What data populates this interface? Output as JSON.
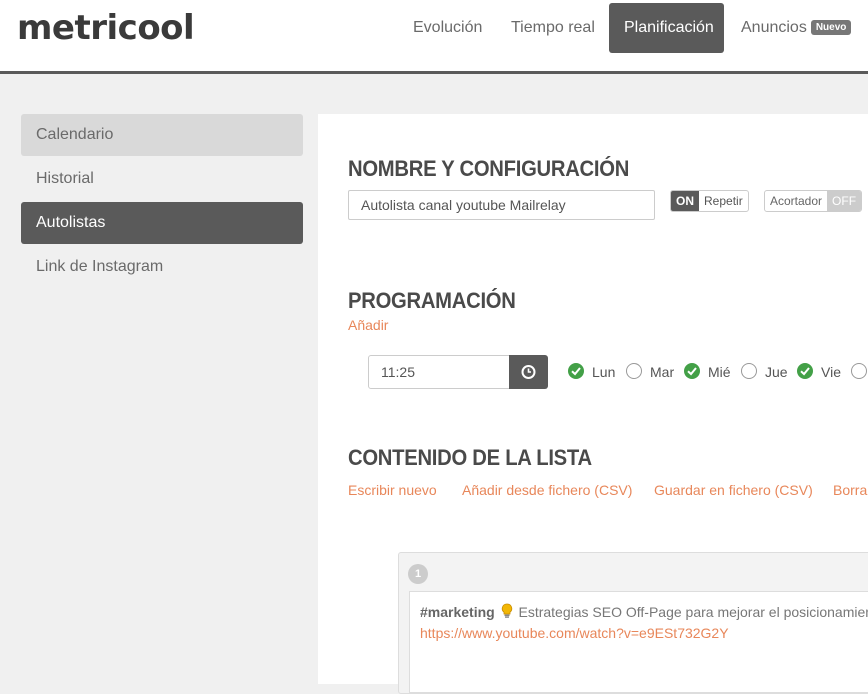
{
  "app": {
    "logo": "metricool"
  },
  "nav": {
    "items": [
      {
        "label": "Evolución"
      },
      {
        "label": "Tiempo real"
      },
      {
        "label": "Planificación"
      },
      {
        "label": "Anuncios",
        "badge": "Nuevo"
      }
    ]
  },
  "sidebar": {
    "items": [
      {
        "label": "Calendario"
      },
      {
        "label": "Historial"
      },
      {
        "label": "Autolistas"
      },
      {
        "label": "Link de Instagram"
      }
    ]
  },
  "config": {
    "title": "NOMBRE Y CONFIGURACIÓN",
    "name_value": "Autolista canal youtube Mailrelay",
    "repeat_on": "ON",
    "repeat_label": "Repetir",
    "shortener_label": "Acortador",
    "shortener_off": "OFF"
  },
  "schedule": {
    "title": "PROGRAMACIÓN",
    "add_link": "Añadir",
    "time_value": "11:25",
    "days": [
      {
        "label": "Lun",
        "checked": true
      },
      {
        "label": "Mar",
        "checked": false
      },
      {
        "label": "Mié",
        "checked": true
      },
      {
        "label": "Jue",
        "checked": false
      },
      {
        "label": "Vie",
        "checked": true
      },
      {
        "label": "",
        "checked": false
      }
    ]
  },
  "content": {
    "title": "CONTENIDO DE LA LISTA",
    "actions": [
      {
        "label": "Escribir nuevo"
      },
      {
        "label": "Añadir desde fichero (CSV)"
      },
      {
        "label": "Guardar en fichero (CSV)"
      },
      {
        "label": "Borra"
      }
    ],
    "items": [
      {
        "number": "1",
        "hashtag": "#marketing",
        "text": "Estrategias SEO Off-Page para mejorar el posicionamiento c",
        "url": "https://www.youtube.com/watch?v=e9ESt732G2Y"
      }
    ]
  },
  "colors": {
    "accent": "#e8875a",
    "dark": "#5a5a5a",
    "check_green": "#43a047",
    "bulb": "#f2b705"
  },
  "icons": {
    "time_button": "clock-icon",
    "day_checked": "check-circle-icon",
    "item_emoji": "light-bulb-icon"
  }
}
